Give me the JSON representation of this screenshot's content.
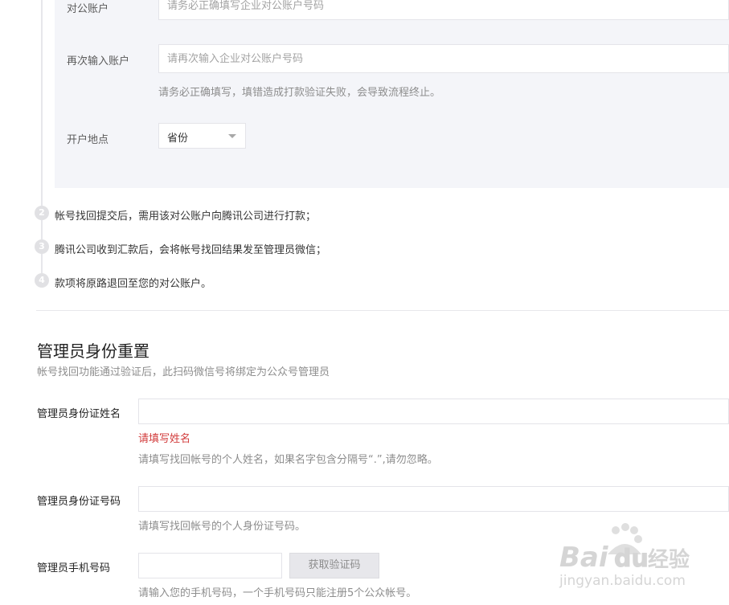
{
  "account_panel": {
    "account_label": "对公账户",
    "account_placeholder": "请务必正确填写企业对公账户号码",
    "confirm_label": "再次输入账户",
    "confirm_placeholder": "请再次输入企业对公账户号码",
    "confirm_hint": "请务必正确填写，填错造成打款验证失败，会导致流程终止。",
    "location_label": "开户地点",
    "province_select_value": "省份"
  },
  "steps": [
    {
      "number": "2",
      "text": "帐号找回提交后，需用该对公账户向腾讯公司进行打款；"
    },
    {
      "number": "3",
      "text": "腾讯公司收到汇款后，会将帐号找回结果发至管理员微信；"
    },
    {
      "number": "4",
      "text": "款项将原路退回至您的对公账户。"
    }
  ],
  "admin_reset": {
    "title": "管理员身份重置",
    "description": "帐号找回功能通过验证后，此扫码微信号将绑定为公众号管理员",
    "name_label": "管理员身份证姓名",
    "name_value": "",
    "name_error": "请填写姓名",
    "name_hint": "请填写找回帐号的个人姓名，如果名字包含分隔号“.”,请勿忽略。",
    "id_label": "管理员身份证号码",
    "id_value": "",
    "id_hint": "请填写找回帐号的个人身份证号码。",
    "phone_label": "管理员手机号码",
    "phone_value": "",
    "get_code_button": "获取验证码",
    "phone_hint": "请输入您的手机号码，一个手机号码只能注册5个公众帐号。"
  },
  "watermark": {
    "brand": "Baidu",
    "brand_cn": "经验",
    "url": "jingyan.baidu.com"
  },
  "colors": {
    "panel_bg": "#f4f5f9",
    "error": "#d23c3c",
    "hint": "#8d8d8d",
    "step_circle": "#e1e1e4"
  }
}
